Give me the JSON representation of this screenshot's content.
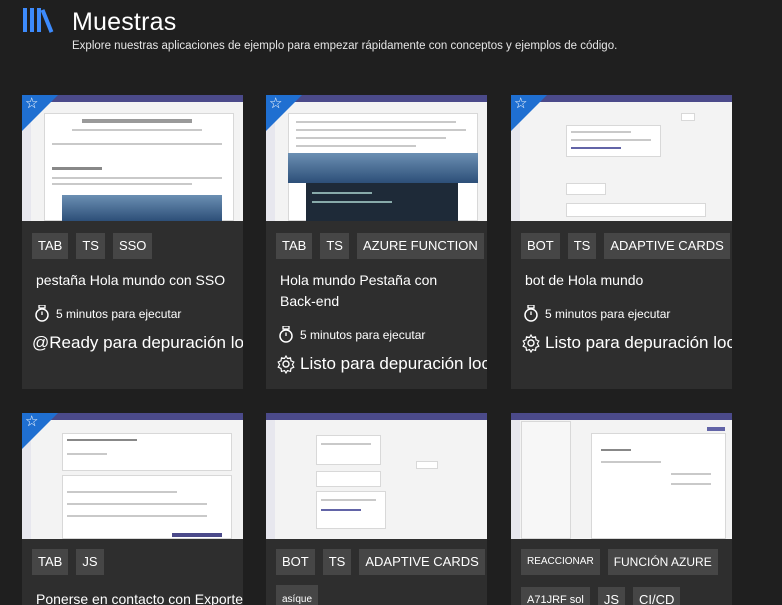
{
  "header": {
    "title": "Muestras",
    "subtitle": "Explore nuestras aplicaciones de ejemplo para empezar rápidamente con conceptos y ejemplos de código."
  },
  "cards": [
    {
      "tags": [
        "TAB",
        "TS",
        "SSO"
      ],
      "title": "pestaña Hola mundo con SSO",
      "time": "5 minutos para ejecutar",
      "status": "@Ready para depuración local"
    },
    {
      "tags": [
        "TAB",
        "TS",
        "AZURE FUNCTION"
      ],
      "title": "Hola mundo Pestaña con Back-end",
      "time": "5 minutos para ejecutar",
      "status": "Listo para depuración local"
    },
    {
      "tags": [
        "BOT",
        "TS",
        "ADAPTIVE CARDS"
      ],
      "title": "bot de Hola mundo",
      "time": "5 minutos para ejecutar",
      "status": "Listo para depuración local"
    },
    {
      "tags": [
        "TAB",
        "JS"
      ],
      "title": "Ponerse en contacto con Exporter usi"
    },
    {
      "tags": [
        "BOT",
        "TS",
        "ADAPTIVE CARDS"
      ],
      "extra_tag": "asíque"
    },
    {
      "tags": [
        "REACCIONAR",
        "FUNCIÓN AZURE"
      ],
      "tags_row2": [
        "A71JRF sol",
        "JS",
        "CI/CD"
      ]
    }
  ],
  "colors": {
    "background": "#1f1f1f",
    "card": "#2e2e2e",
    "tag": "#464646",
    "accent": "#1f6fd1"
  },
  "icons": {
    "logo": "library-books-icon",
    "featured": "star-icon",
    "time": "stopwatch-icon",
    "status": "gear-icon"
  }
}
